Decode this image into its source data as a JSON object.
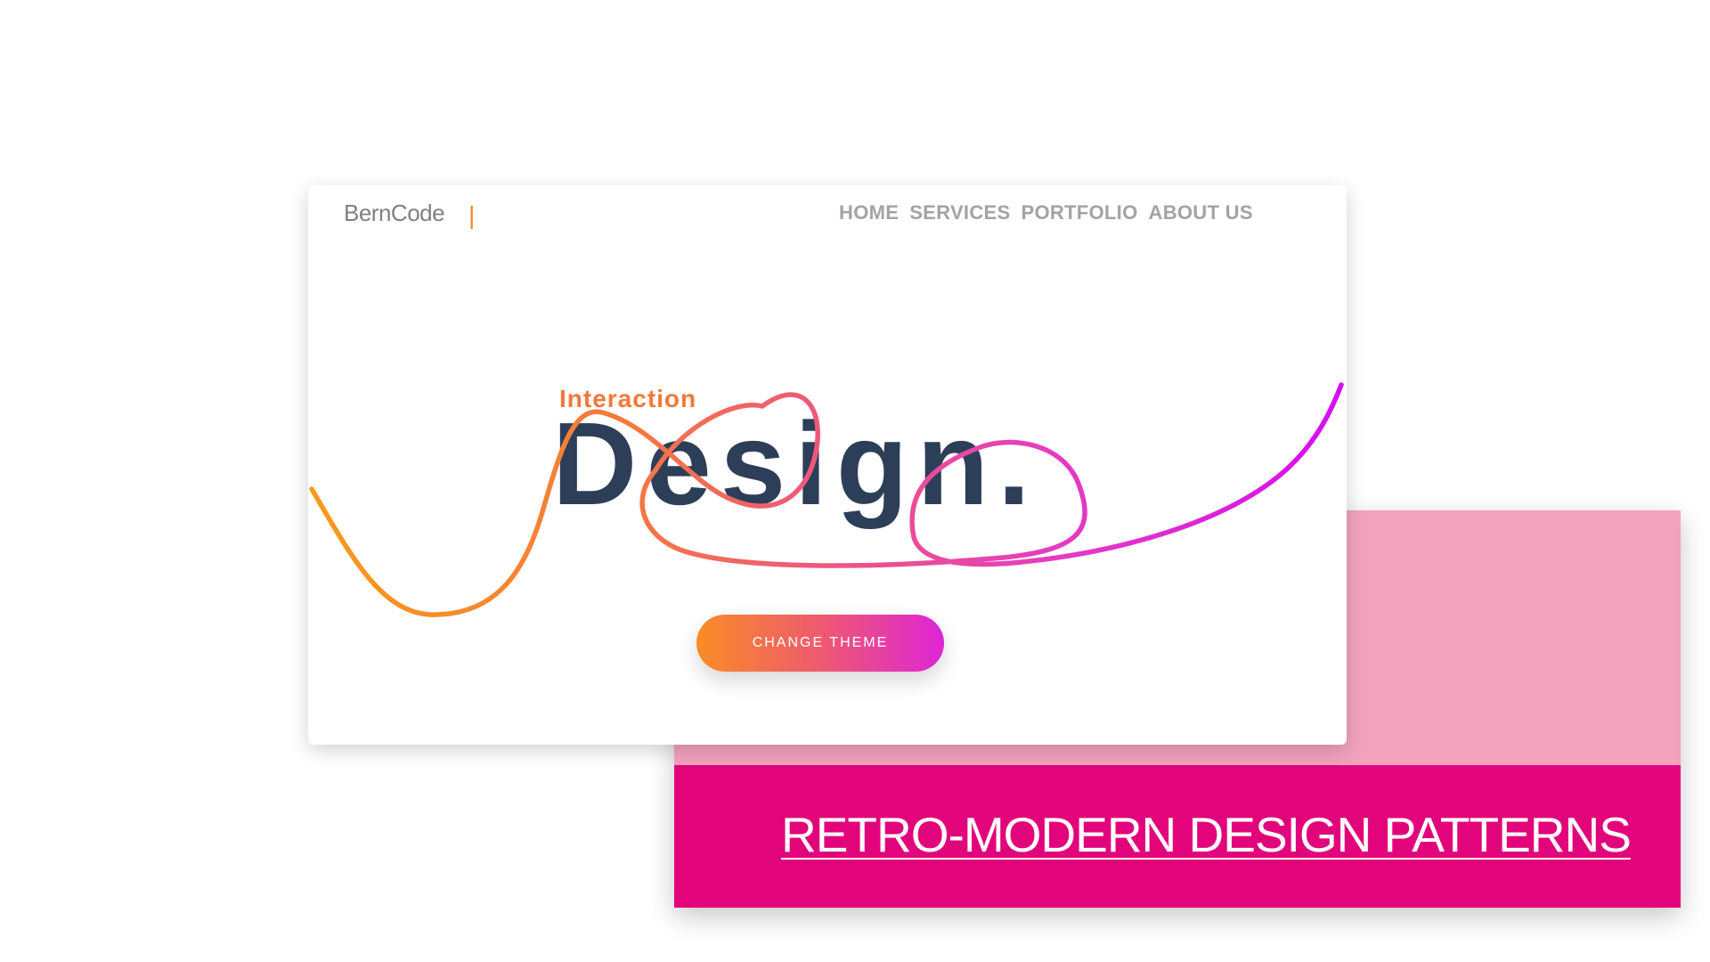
{
  "site": {
    "logo": "BernCode",
    "logo_cursor": "|",
    "nav": [
      "HOME",
      "SERVICES",
      "PORTFOLIO",
      "ABOUT US"
    ]
  },
  "hero": {
    "subtitle": "Interaction",
    "title": "Design.",
    "cta_label": "CHANGE THEME"
  },
  "banner": {
    "title": "RETRO-MODERN DESIGN PATTERNS"
  },
  "colors": {
    "accent_orange": "#f5832a",
    "accent_magenta": "#de25d6",
    "banner_pink": "#e2047b",
    "panel_light_pink": "#f2a2bd",
    "title_navy": "#2d3e58"
  }
}
